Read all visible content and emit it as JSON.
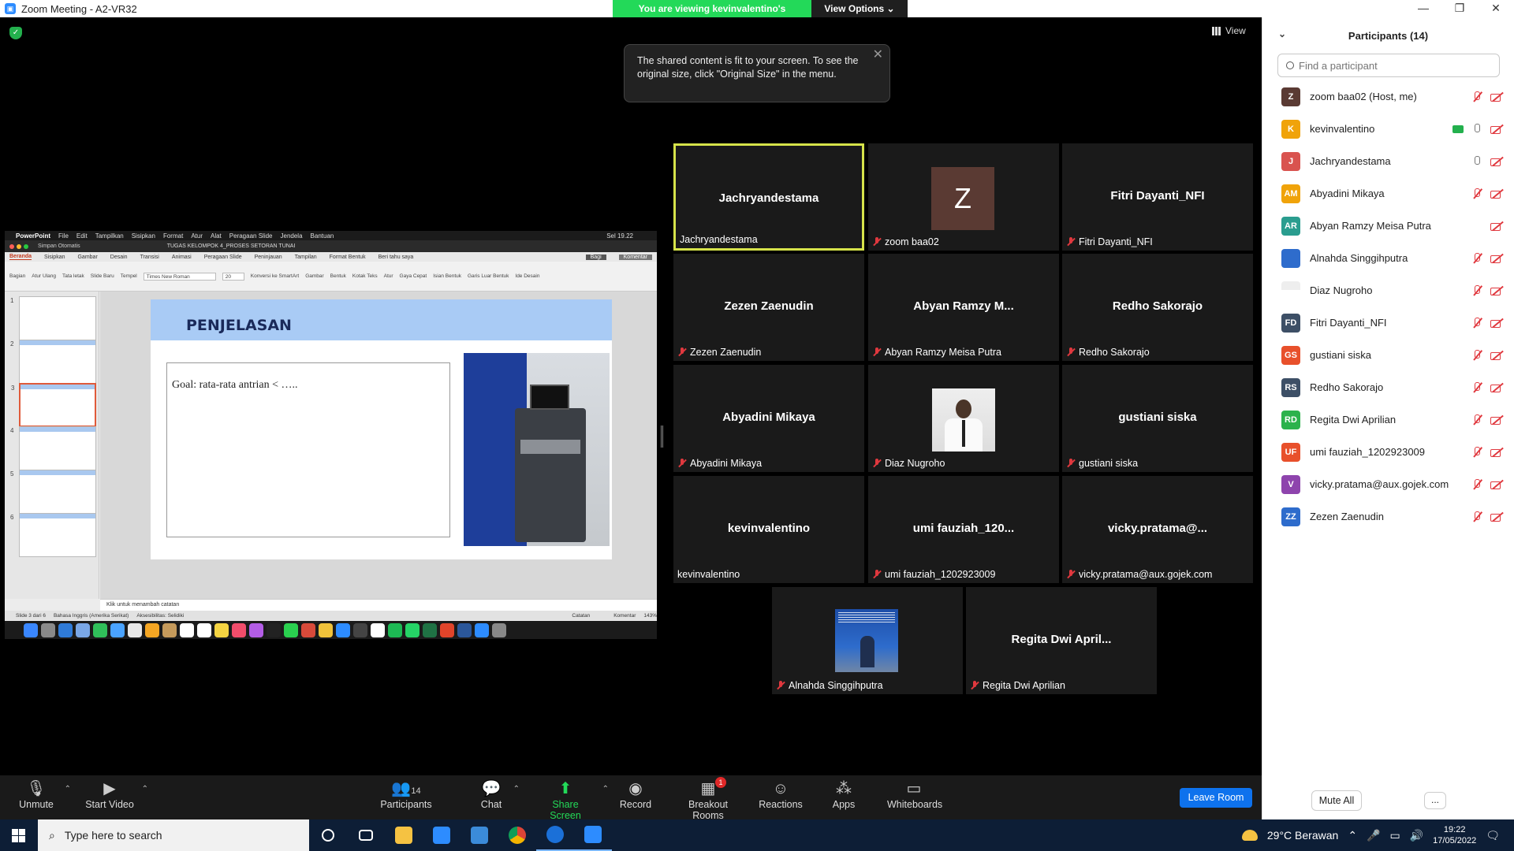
{
  "window": {
    "title": "Zoom Meeting - A2-VR32",
    "banner_text": "You are viewing kevinvalentino's screen",
    "view_options_label": "View Options",
    "view_label": "View"
  },
  "tooltip": {
    "text": "The shared content is fit to your screen. To see the original size, click \"Original Size\" in the menu."
  },
  "shared_screen": {
    "menubar": [
      "PowerPoint",
      "File",
      "Edit",
      "Tampilkan",
      "Sisipkan",
      "Format",
      "Atur",
      "Alat",
      "Peragaan Slide",
      "Jendela",
      "Bantuan"
    ],
    "menubar_time": "Sel 19.22",
    "autosave": "Simpan Otomatis",
    "filename": "TUGAS KELOMPOK 4_PROSES SETORAN TUNAI",
    "tabs": [
      "Beranda",
      "Sisipkan",
      "Gambar",
      "Desain",
      "Transisi",
      "Animasi",
      "Peragaan Slide",
      "Peninjauan",
      "Tampilan",
      "Format Bentuk",
      "Beri tahu saya"
    ],
    "share_btn": "Bagi",
    "comment_btn": "Komentar",
    "font_name": "Times New Roman",
    "font_size": "20",
    "ribbon_items": [
      "Tempel",
      "Slide Baru",
      "Tata letak",
      "Atur Ulang",
      "Bagian",
      "Konversi ke SmartArt",
      "Gambar",
      "Bentuk",
      "Kotak Teks",
      "Atur",
      "Gaya Cepat",
      "Isian Bentuk",
      "Garis Luar Bentuk",
      "Ide Desain"
    ],
    "thumbnails": [
      "1",
      "2",
      "3",
      "4",
      "5",
      "6"
    ],
    "slide_title": "PENJELASAN",
    "slide_text": "Goal: rata-rata antrian < …..",
    "notes_placeholder": "Klik untuk menambah catatan",
    "status_slide": "Slide 3 dari 6",
    "status_lang": "Bahasa Inggris (Amerika Serikat)",
    "status_access": "Aksesibilitas: Selidiki",
    "status_notes": "Catatan",
    "status_comments": "Komentar",
    "zoom_level": "143%"
  },
  "tiles": [
    {
      "center": "Jachryandestama",
      "label": "Jachryandestama",
      "muted": false,
      "active": true
    },
    {
      "center": "",
      "label": "zoom baa02",
      "muted": true,
      "avatar": "Z"
    },
    {
      "center": "Fitri Dayanti_NFI",
      "label": "Fitri Dayanti_NFI",
      "muted": true
    },
    {
      "center": "Zezen Zaenudin",
      "label": "Zezen Zaenudin",
      "muted": true
    },
    {
      "center": "Abyan Ramzy M...",
      "label": "Abyan Ramzy Meisa Putra",
      "muted": true
    },
    {
      "center": "Redho Sakorajo",
      "label": "Redho Sakorajo",
      "muted": true
    },
    {
      "center": "Abyadini Mikaya",
      "label": "Abyadini Mikaya",
      "muted": true
    },
    {
      "center": "",
      "label": "Diaz Nugroho",
      "muted": true
    },
    {
      "center": "gustiani siska",
      "label": "gustiani siska",
      "muted": true
    },
    {
      "center": "kevinvalentino",
      "label": "kevinvalentino",
      "muted": false
    },
    {
      "center": "umi  fauziah_120...",
      "label": "umi fauziah_1202923009",
      "muted": true
    },
    {
      "center": "vicky.pratama@...",
      "label": "vicky.pratama@aux.gojek.com",
      "muted": true
    },
    {
      "center": "",
      "label": "Alnahda Singgihputra",
      "muted": true
    },
    {
      "center": "Regita Dwi April...",
      "label": "Regita Dwi Aprilian",
      "muted": true
    }
  ],
  "participants": {
    "title": "Participants (14)",
    "search_placeholder": "Find a participant",
    "list": [
      {
        "initials": "Z",
        "name": "zoom baa02 (Host, me)",
        "color": "#5a3a33"
      },
      {
        "initials": "K",
        "name": "kevinvalentino",
        "color": "#f0a30a"
      },
      {
        "initials": "J",
        "name": "Jachryandestama",
        "color": "#d9534f"
      },
      {
        "initials": "AM",
        "name": "Abyadini Mikaya",
        "color": "#f0a30a"
      },
      {
        "initials": "AR",
        "name": "Abyan Ramzy Meisa Putra",
        "color": "#2a9d8f"
      },
      {
        "initials": "",
        "name": "Alnahda Singgihputra",
        "color": "#2e6ccc"
      },
      {
        "initials": "",
        "name": "Diaz Nugroho",
        "color": "#eeeeee"
      },
      {
        "initials": "FD",
        "name": "Fitri Dayanti_NFI",
        "color": "#3d4f66"
      },
      {
        "initials": "GS",
        "name": "gustiani siska",
        "color": "#e8502b"
      },
      {
        "initials": "RS",
        "name": "Redho Sakorajo",
        "color": "#3d4f66"
      },
      {
        "initials": "RD",
        "name": "Regita Dwi Aprilian",
        "color": "#2bb24c"
      },
      {
        "initials": "UF",
        "name": "umi fauziah_1202923009",
        "color": "#e8502b"
      },
      {
        "initials": "V",
        "name": "vicky.pratama@aux.gojek.com",
        "color": "#8e44ad"
      },
      {
        "initials": "ZZ",
        "name": "Zezen Zaenudin",
        "color": "#2e6ccc"
      }
    ],
    "mute_all": "Mute All",
    "more": "..."
  },
  "toolbar": {
    "unmute": "Unmute",
    "start_video": "Start Video",
    "participants": "Participants",
    "participants_count": "14",
    "chat": "Chat",
    "share_screen": "Share Screen",
    "record": "Record",
    "breakout": "Breakout Rooms",
    "breakout_badge": "1",
    "reactions": "Reactions",
    "apps": "Apps",
    "whiteboards": "Whiteboards",
    "leave": "Leave Room"
  },
  "taskbar": {
    "search_placeholder": "Type here to search",
    "weather": "29°C  Berawan",
    "time": "19:22",
    "date": "17/05/2022"
  }
}
